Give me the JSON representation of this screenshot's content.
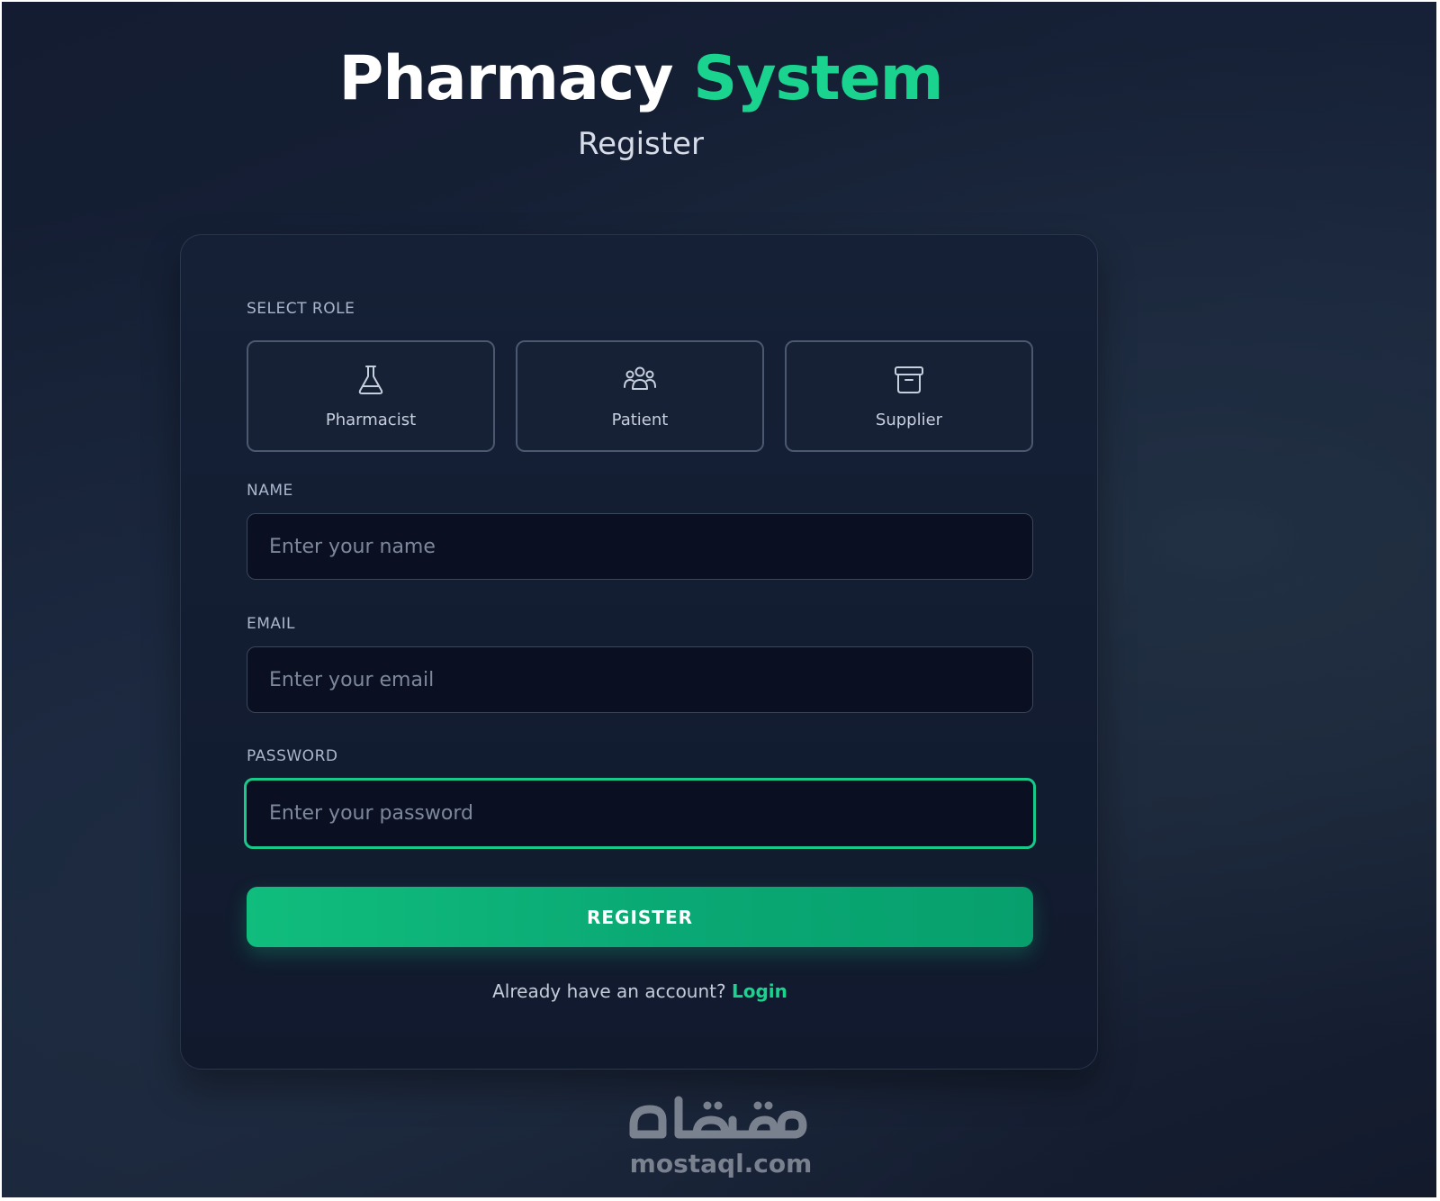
{
  "header": {
    "title_main": "Pharmacy",
    "title_accent": "System",
    "subtitle": "Register"
  },
  "form": {
    "role_label": "SELECT ROLE",
    "roles": [
      {
        "label": "Pharmacist",
        "icon": "flask-icon"
      },
      {
        "label": "Patient",
        "icon": "users-icon"
      },
      {
        "label": "Supplier",
        "icon": "archive-box-icon"
      }
    ],
    "name": {
      "label": "NAME",
      "placeholder": "Enter your name",
      "value": ""
    },
    "email": {
      "label": "EMAIL",
      "placeholder": "Enter your email",
      "value": ""
    },
    "password": {
      "label": "PASSWORD",
      "placeholder": "Enter your password",
      "value": ""
    },
    "submit_label": "REGISTER",
    "login_prompt": "Already have an account?",
    "login_link": "Login"
  },
  "watermark": {
    "text": "mostaql.com",
    "logo_text": "مستقل"
  },
  "colors": {
    "accent": "#19d38f",
    "button": "#10bd7d",
    "background": "#16203a",
    "card": "#131d31",
    "input_bg": "#0a1022"
  }
}
